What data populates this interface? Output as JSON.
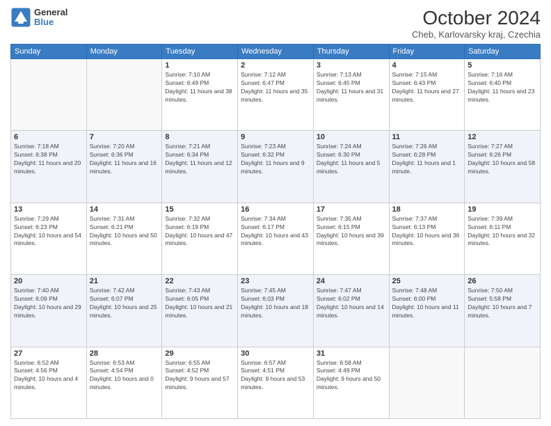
{
  "header": {
    "logo_line1": "General",
    "logo_line2": "Blue",
    "month_title": "October 2024",
    "location": "Cheb, Karlovarsky kraj, Czechia"
  },
  "weekdays": [
    "Sunday",
    "Monday",
    "Tuesday",
    "Wednesday",
    "Thursday",
    "Friday",
    "Saturday"
  ],
  "weeks": [
    [
      {
        "day": "",
        "sunrise": "",
        "sunset": "",
        "daylight": ""
      },
      {
        "day": "",
        "sunrise": "",
        "sunset": "",
        "daylight": ""
      },
      {
        "day": "1",
        "sunrise": "Sunrise: 7:10 AM",
        "sunset": "Sunset: 6:49 PM",
        "daylight": "Daylight: 11 hours and 38 minutes."
      },
      {
        "day": "2",
        "sunrise": "Sunrise: 7:12 AM",
        "sunset": "Sunset: 6:47 PM",
        "daylight": "Daylight: 11 hours and 35 minutes."
      },
      {
        "day": "3",
        "sunrise": "Sunrise: 7:13 AM",
        "sunset": "Sunset: 6:45 PM",
        "daylight": "Daylight: 11 hours and 31 minutes."
      },
      {
        "day": "4",
        "sunrise": "Sunrise: 7:15 AM",
        "sunset": "Sunset: 6:43 PM",
        "daylight": "Daylight: 11 hours and 27 minutes."
      },
      {
        "day": "5",
        "sunrise": "Sunrise: 7:16 AM",
        "sunset": "Sunset: 6:40 PM",
        "daylight": "Daylight: 11 hours and 23 minutes."
      }
    ],
    [
      {
        "day": "6",
        "sunrise": "Sunrise: 7:18 AM",
        "sunset": "Sunset: 6:38 PM",
        "daylight": "Daylight: 11 hours and 20 minutes."
      },
      {
        "day": "7",
        "sunrise": "Sunrise: 7:20 AM",
        "sunset": "Sunset: 6:36 PM",
        "daylight": "Daylight: 11 hours and 16 minutes."
      },
      {
        "day": "8",
        "sunrise": "Sunrise: 7:21 AM",
        "sunset": "Sunset: 6:34 PM",
        "daylight": "Daylight: 11 hours and 12 minutes."
      },
      {
        "day": "9",
        "sunrise": "Sunrise: 7:23 AM",
        "sunset": "Sunset: 6:32 PM",
        "daylight": "Daylight: 11 hours and 9 minutes."
      },
      {
        "day": "10",
        "sunrise": "Sunrise: 7:24 AM",
        "sunset": "Sunset: 6:30 PM",
        "daylight": "Daylight: 11 hours and 5 minutes."
      },
      {
        "day": "11",
        "sunrise": "Sunrise: 7:26 AM",
        "sunset": "Sunset: 6:28 PM",
        "daylight": "Daylight: 11 hours and 1 minute."
      },
      {
        "day": "12",
        "sunrise": "Sunrise: 7:27 AM",
        "sunset": "Sunset: 6:26 PM",
        "daylight": "Daylight: 10 hours and 58 minutes."
      }
    ],
    [
      {
        "day": "13",
        "sunrise": "Sunrise: 7:29 AM",
        "sunset": "Sunset: 6:23 PM",
        "daylight": "Daylight: 10 hours and 54 minutes."
      },
      {
        "day": "14",
        "sunrise": "Sunrise: 7:31 AM",
        "sunset": "Sunset: 6:21 PM",
        "daylight": "Daylight: 10 hours and 50 minutes."
      },
      {
        "day": "15",
        "sunrise": "Sunrise: 7:32 AM",
        "sunset": "Sunset: 6:19 PM",
        "daylight": "Daylight: 10 hours and 47 minutes."
      },
      {
        "day": "16",
        "sunrise": "Sunrise: 7:34 AM",
        "sunset": "Sunset: 6:17 PM",
        "daylight": "Daylight: 10 hours and 43 minutes."
      },
      {
        "day": "17",
        "sunrise": "Sunrise: 7:35 AM",
        "sunset": "Sunset: 6:15 PM",
        "daylight": "Daylight: 10 hours and 39 minutes."
      },
      {
        "day": "18",
        "sunrise": "Sunrise: 7:37 AM",
        "sunset": "Sunset: 6:13 PM",
        "daylight": "Daylight: 10 hours and 36 minutes."
      },
      {
        "day": "19",
        "sunrise": "Sunrise: 7:39 AM",
        "sunset": "Sunset: 6:11 PM",
        "daylight": "Daylight: 10 hours and 32 minutes."
      }
    ],
    [
      {
        "day": "20",
        "sunrise": "Sunrise: 7:40 AM",
        "sunset": "Sunset: 6:09 PM",
        "daylight": "Daylight: 10 hours and 29 minutes."
      },
      {
        "day": "21",
        "sunrise": "Sunrise: 7:42 AM",
        "sunset": "Sunset: 6:07 PM",
        "daylight": "Daylight: 10 hours and 25 minutes."
      },
      {
        "day": "22",
        "sunrise": "Sunrise: 7:43 AM",
        "sunset": "Sunset: 6:05 PM",
        "daylight": "Daylight: 10 hours and 21 minutes."
      },
      {
        "day": "23",
        "sunrise": "Sunrise: 7:45 AM",
        "sunset": "Sunset: 6:03 PM",
        "daylight": "Daylight: 10 hours and 18 minutes."
      },
      {
        "day": "24",
        "sunrise": "Sunrise: 7:47 AM",
        "sunset": "Sunset: 6:02 PM",
        "daylight": "Daylight: 10 hours and 14 minutes."
      },
      {
        "day": "25",
        "sunrise": "Sunrise: 7:48 AM",
        "sunset": "Sunset: 6:00 PM",
        "daylight": "Daylight: 10 hours and 11 minutes."
      },
      {
        "day": "26",
        "sunrise": "Sunrise: 7:50 AM",
        "sunset": "Sunset: 5:58 PM",
        "daylight": "Daylight: 10 hours and 7 minutes."
      }
    ],
    [
      {
        "day": "27",
        "sunrise": "Sunrise: 6:52 AM",
        "sunset": "Sunset: 4:56 PM",
        "daylight": "Daylight: 10 hours and 4 minutes."
      },
      {
        "day": "28",
        "sunrise": "Sunrise: 6:53 AM",
        "sunset": "Sunset: 4:54 PM",
        "daylight": "Daylight: 10 hours and 0 minutes."
      },
      {
        "day": "29",
        "sunrise": "Sunrise: 6:55 AM",
        "sunset": "Sunset: 4:52 PM",
        "daylight": "Daylight: 9 hours and 57 minutes."
      },
      {
        "day": "30",
        "sunrise": "Sunrise: 6:57 AM",
        "sunset": "Sunset: 4:51 PM",
        "daylight": "Daylight: 9 hours and 53 minutes."
      },
      {
        "day": "31",
        "sunrise": "Sunrise: 6:58 AM",
        "sunset": "Sunset: 4:49 PM",
        "daylight": "Daylight: 9 hours and 50 minutes."
      },
      {
        "day": "",
        "sunrise": "",
        "sunset": "",
        "daylight": ""
      },
      {
        "day": "",
        "sunrise": "",
        "sunset": "",
        "daylight": ""
      }
    ]
  ]
}
